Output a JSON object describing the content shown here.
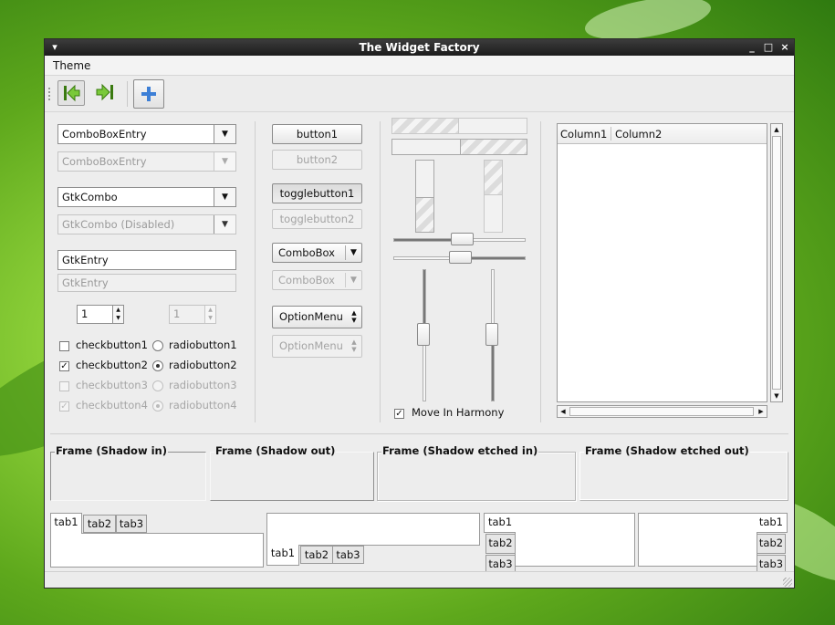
{
  "window": {
    "title": "The Widget Factory",
    "controls": [
      "_",
      "□",
      "×"
    ]
  },
  "menubar": {
    "theme": "Theme"
  },
  "toolbar": {
    "prev_icon": "go-first-icon",
    "next_icon": "go-last-icon",
    "add_icon": "add-icon"
  },
  "col1": {
    "combo_entry": "ComboBoxEntry",
    "combo_entry_dis": "ComboBoxEntry",
    "gtk_combo": "GtkCombo",
    "gtk_combo_dis": "GtkCombo (Disabled)",
    "entry": "GtkEntry",
    "entry_dis": "GtkEntry",
    "spin": "1",
    "spin_dis": "1",
    "checks": [
      "checkbutton1",
      "checkbutton2",
      "checkbutton3",
      "checkbutton4"
    ],
    "radios": [
      "radiobutton1",
      "radiobutton2",
      "radiobutton3",
      "radiobutton4"
    ]
  },
  "col2": {
    "button1": "button1",
    "button2": "button2",
    "toggle1": "togglebutton1",
    "toggle2": "togglebutton2",
    "combobox": "ComboBox",
    "combobox_dis": "ComboBox",
    "optionmenu": "OptionMenu",
    "optionmenu_dis": "OptionMenu"
  },
  "col3": {
    "move_in_harmony": "Move In Harmony"
  },
  "tree": {
    "columns": [
      "Column1",
      "Column2"
    ]
  },
  "frames": [
    "Frame (Shadow in)",
    "Frame (Shadow out)",
    "Frame (Shadow etched in)",
    "Frame (Shadow etched out)"
  ],
  "notebooks": {
    "tabs": [
      "tab1",
      "tab2",
      "tab3"
    ]
  }
}
